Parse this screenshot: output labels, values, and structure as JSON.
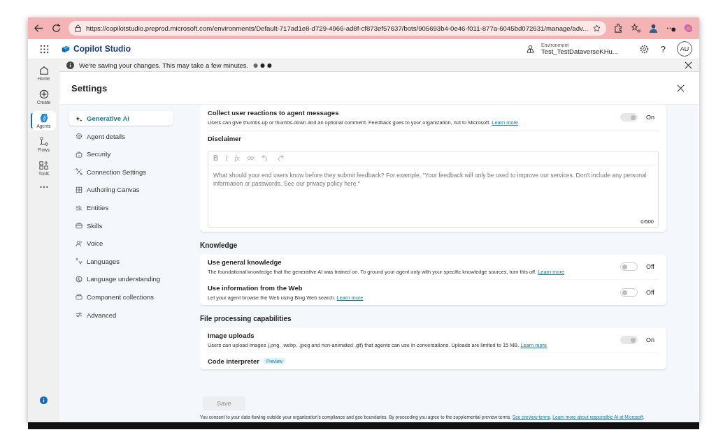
{
  "browser": {
    "url": "https://copilotstudio.preprod.microsoft.com/environments/Default-717ad1e8-d729-4966-ad8f-cf873ef57637/bots/905693b4-0e46-f011-877a-6045bd072631/manage/adv..."
  },
  "app": {
    "title": "Copilot Studio",
    "environment_label": "Environment",
    "environment_name": "Test_TestDataverseKHu...",
    "help": "?",
    "avatar": "AU"
  },
  "rail": [
    {
      "label": "Home",
      "selected": false
    },
    {
      "label": "Create",
      "selected": false
    },
    {
      "label": "Agents",
      "selected": true
    },
    {
      "label": "Flows",
      "selected": false
    },
    {
      "label": "Tools",
      "selected": false
    }
  ],
  "notification": {
    "text": "We're saving your changes. This may take a few minutes."
  },
  "settings": {
    "title": "Settings",
    "nav": [
      {
        "label": "Generative AI",
        "selected": true
      },
      {
        "label": "Agent details",
        "selected": false
      },
      {
        "label": "Security",
        "selected": false
      },
      {
        "label": "Connection Settings",
        "selected": false
      },
      {
        "label": "Authoring Canvas",
        "selected": false
      },
      {
        "label": "Entities",
        "selected": false
      },
      {
        "label": "Skills",
        "selected": false
      },
      {
        "label": "Voice",
        "selected": false
      },
      {
        "label": "Languages",
        "selected": false
      },
      {
        "label": "Language understanding",
        "selected": false
      },
      {
        "label": "Component collections",
        "selected": false
      },
      {
        "label": "Advanced",
        "selected": false
      }
    ],
    "sections": [
      {
        "rows": [
          {
            "kind": "toggle",
            "title": "Collect user reactions to agent messages",
            "description": "Users can give thumbs-up or thumbs-down and an optional comment. Feedback goes to your organization, not to Microsoft.",
            "link": "Learn more",
            "on": true,
            "state_label": "On"
          },
          {
            "kind": "editor",
            "title": "Disclaimer",
            "toolbar": [
              "B",
              "I",
              "fx"
            ],
            "placeholder": "What should your end users know before they submit feedback? For example, \"Your feedback will only be used to improve our services. Don't include any personal information or passwords. See our privacy policy here.\"",
            "counter": "0/500"
          }
        ]
      },
      {
        "heading": "Knowledge",
        "rows": [
          {
            "kind": "toggle",
            "title": "Use general knowledge",
            "description": "The foundational knowledge that the generative AI was trained on. To ground your agent only with your specific knowledge sources, turn this off.",
            "link": "Learn more",
            "on": false,
            "state_label": "Off"
          },
          {
            "kind": "toggle",
            "title": "Use information from the Web",
            "description": "Let your agent browse the Web using Bing Web search.",
            "link": "Learn more",
            "on": false,
            "state_label": "Off"
          }
        ]
      },
      {
        "heading": "File processing capabilities",
        "rows": [
          {
            "kind": "toggle",
            "title": "Image uploads",
            "description": "Users can upload images (.png, .webp, .jpeg and non-animated .gif) that agents can use in conversations. Uploads are limited to 15 MB.",
            "link": "Learn more",
            "on": true,
            "state_label": "On"
          },
          {
            "kind": "badge",
            "title": "Code interpreter",
            "badge": "Preview"
          }
        ]
      }
    ],
    "save": {
      "label": "Save",
      "disabled": true
    },
    "footer": [
      {
        "kind": "text",
        "text": "You consent to your data flowing outside your organization's compliance and geo boundaries. By proceeding you agree to the supplemental preview terms. "
      },
      {
        "kind": "link",
        "text": "See preview terms"
      },
      {
        "kind": "text",
        "text": ". "
      },
      {
        "kind": "link",
        "text": "Learn more about responsible AI at Microsoft"
      },
      {
        "kind": "text",
        "text": "."
      }
    ]
  }
}
